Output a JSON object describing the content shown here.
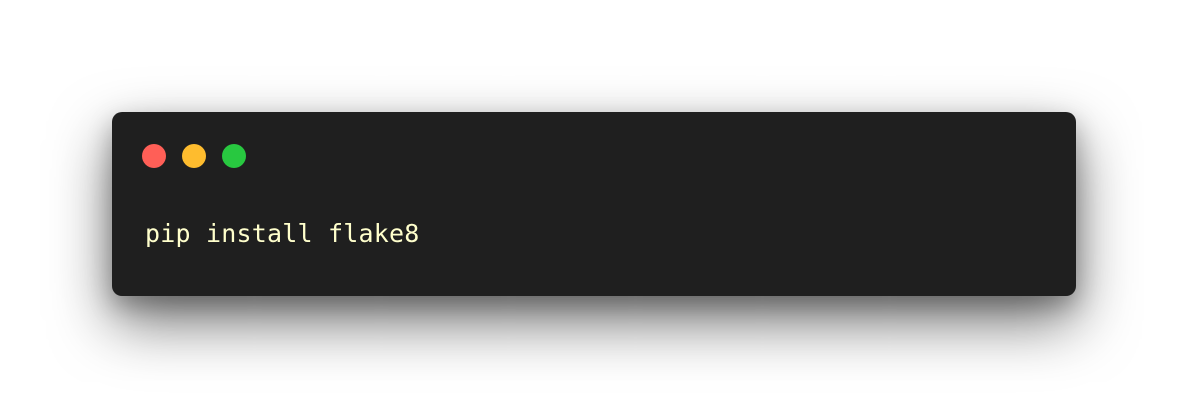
{
  "window": {
    "controls": [
      {
        "name": "close",
        "color": "#ff5f57"
      },
      {
        "name": "minimize",
        "color": "#febc2e"
      },
      {
        "name": "zoom",
        "color": "#28c840"
      }
    ]
  },
  "code": {
    "text": "pip install flake8",
    "color": "#ffffcc"
  },
  "colors": {
    "window_bg": "#1f1f1f",
    "page_bg": "#ffffff"
  }
}
